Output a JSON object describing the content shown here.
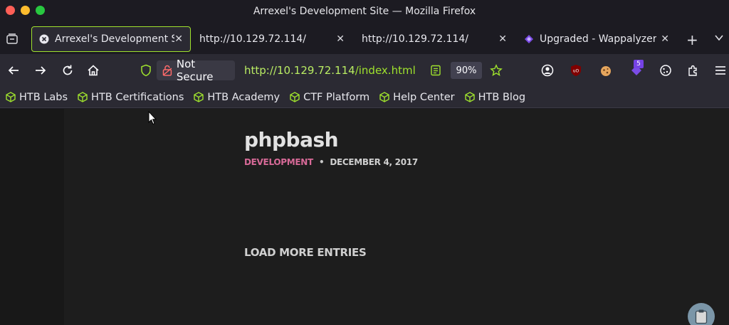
{
  "window": {
    "title": "Arrexel's Development Site — Mozilla Firefox"
  },
  "tabs": [
    {
      "label": "Arrexel's Development Si",
      "active": true,
      "icon": "site-icon"
    },
    {
      "label": "http://10.129.72.114/",
      "active": false
    },
    {
      "label": "http://10.129.72.114/",
      "active": false
    },
    {
      "label": "Upgraded - Wappalyzer",
      "active": false,
      "icon": "wappalyzer-icon"
    }
  ],
  "nav": {
    "security_label": "Not Secure",
    "url_host": "http://10.129.72.114",
    "url_path": "/index.html",
    "zoom": "90%",
    "extension_badge": "5"
  },
  "bookmarks": [
    {
      "label": "HTB Labs"
    },
    {
      "label": "HTB Certifications"
    },
    {
      "label": "HTB Academy"
    },
    {
      "label": "CTF Platform"
    },
    {
      "label": "Help Center"
    },
    {
      "label": "HTB Blog"
    }
  ],
  "post": {
    "title": "phpbash",
    "category": "DEVELOPMENT",
    "separator": "•",
    "date": "DECEMBER 4, 2017",
    "load_more": "LOAD MORE ENTRIES"
  },
  "colors": {
    "accent": "#9fe22d",
    "category": "#d86a98",
    "toolbar": "#2b2a33",
    "page_bg": "#1d1d1d"
  }
}
